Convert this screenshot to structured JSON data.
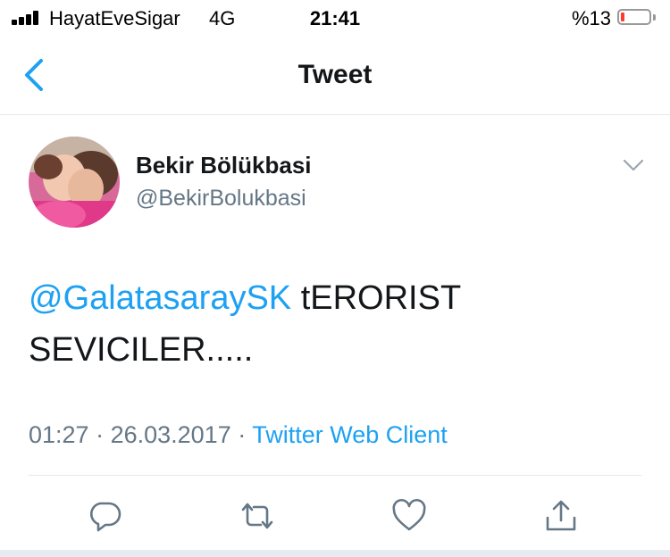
{
  "status_bar": {
    "carrier": "HayatEveSigar",
    "network": "4G",
    "time": "21:41",
    "battery_percent": "%13",
    "battery_level": 0.13
  },
  "nav": {
    "title": "Tweet"
  },
  "tweet": {
    "display_name": "Bekir Bölükbasi",
    "handle": "@BekirBolukbasi",
    "mention": "@GalatasaraySK",
    "text_line1": " tERORIST",
    "text_line2": "SEVICILER.....",
    "time": "01:27",
    "separator1": " · ",
    "date": "26.03.2017",
    "separator2": " · ",
    "client": "Twitter Web Client"
  },
  "icons": {
    "back": "chevron-left-icon",
    "more": "chevron-down-icon",
    "reply": "reply-icon",
    "retweet": "retweet-icon",
    "like": "heart-icon",
    "share": "share-icon"
  },
  "colors": {
    "accent": "#1da1f2",
    "secondary_text": "#657786",
    "primary_text": "#14171a",
    "battery_low": "#ff3b30"
  }
}
